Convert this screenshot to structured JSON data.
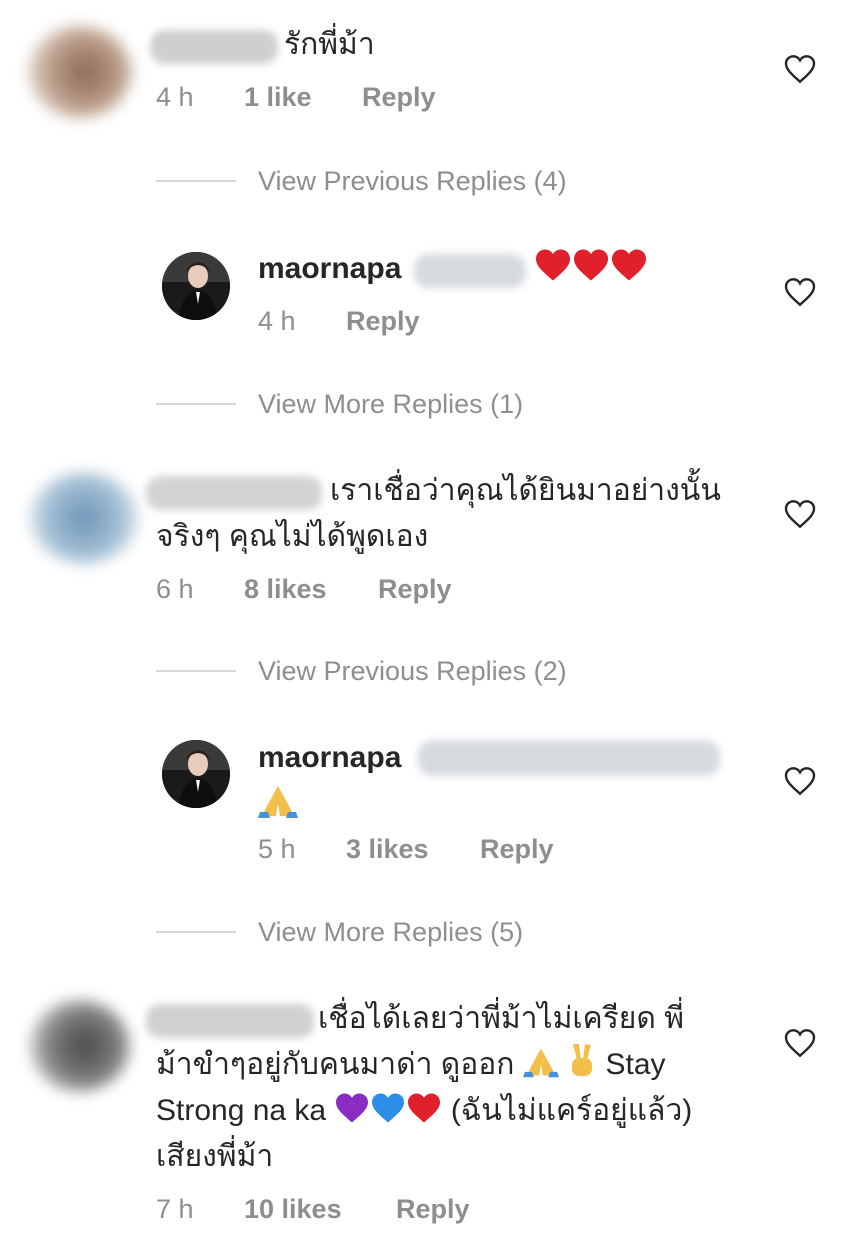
{
  "comments": [
    {
      "text": "รักพี่ม้า",
      "time": "4 h",
      "likes": "1 like",
      "reply": "Reply"
    },
    {
      "line1": "เราเชื่อว่าคุณได้ยินมาอย่างนั้น",
      "line2": "จริงๆ คุณไม่ได้พูดเอง",
      "time": "6 h",
      "likes": "8 likes",
      "reply": "Reply"
    },
    {
      "line1": "เชื่อได้เลยว่าพี่ม้าไม่เครียด พี่",
      "line2": "ม้าขำๆอยู่กับคนมาด่า ดูออก",
      "line2_tail": "Stay",
      "line3": "Strong na ka",
      "line3_tail": "(ฉันไม่แคร์อยู่แล้ว)",
      "line4": "เสียงพี่ม้า",
      "time": "7 h",
      "likes": "10 likes",
      "reply": "Reply"
    }
  ],
  "replies": [
    {
      "username": "maornapa",
      "time": "4 h",
      "reply": "Reply"
    },
    {
      "username": "maornapa",
      "time": "5 h",
      "likes": "3 likes",
      "reply": "Reply"
    }
  ],
  "threads": [
    {
      "label": "View Previous Replies (4)"
    },
    {
      "label": "View More Replies (1)"
    },
    {
      "label": "View Previous Replies (2)"
    },
    {
      "label": "View More Replies (5)"
    }
  ],
  "colors": {
    "text": "#262626",
    "meta": "#8e8e8e",
    "divider": "#d8d8d8",
    "heart_red": "#e0202b",
    "heart_purple": "#8a2cc4",
    "heart_blue": "#2c8ee6",
    "pray_emoji": "#f2c04a"
  },
  "icons": [
    "heart-outline-icon",
    "red-heart-emoji",
    "purple-heart-emoji",
    "blue-heart-emoji",
    "folded-hands-emoji",
    "victory-hand-emoji"
  ]
}
